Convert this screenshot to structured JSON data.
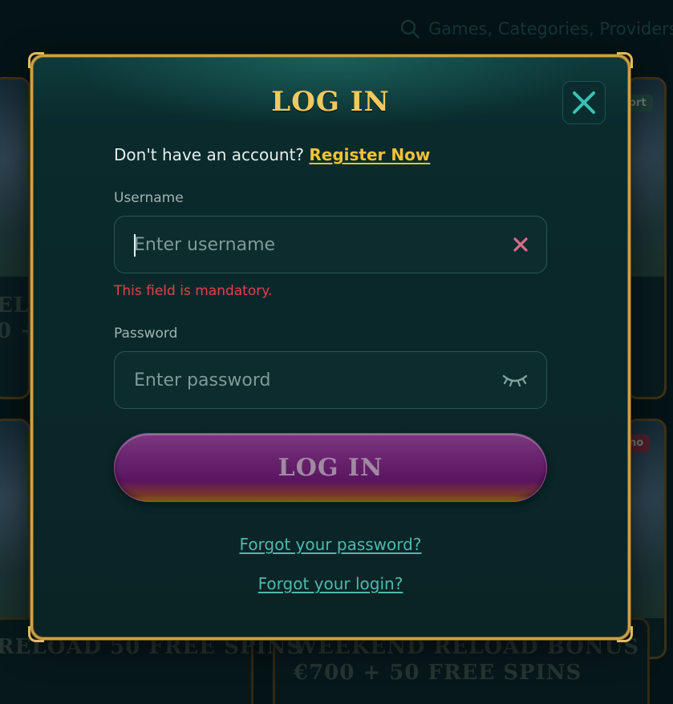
{
  "background": {
    "search_placeholder": "Games, Categories, Providers",
    "cards": [
      {
        "title_line1": "RELOAD 50 FREE SPINS"
      },
      {
        "title_line1": "WEEKEND RELOAD BONUS",
        "title_line2": "€700 + 50 FREE SPINS"
      }
    ],
    "left_card_fragments": {
      "line1": "ELO",
      "line2": "0 +"
    },
    "right_tags": {
      "top": "ort",
      "bottom": "no"
    }
  },
  "modal": {
    "title": "LOG IN",
    "register_prompt": "Don't have an account?",
    "register_link": "Register Now",
    "username": {
      "label": "Username",
      "placeholder": "Enter username",
      "value": "",
      "error": "This field is mandatory."
    },
    "password": {
      "label": "Password",
      "placeholder": "Enter password",
      "value": ""
    },
    "submit_label": "LOG IN",
    "forgot_password": "Forgot your password?",
    "forgot_login": "Forgot your login?"
  },
  "colors": {
    "accent_gold": "#f3c85f",
    "link_gold": "#f1c232",
    "error_red": "#e0424f",
    "link_teal": "#4fb8ab",
    "button_purple": "#6a2470"
  },
  "icons": {
    "search": "search-icon",
    "close": "close-icon",
    "clear": "clear-icon",
    "eye_closed": "eye-closed-icon"
  }
}
